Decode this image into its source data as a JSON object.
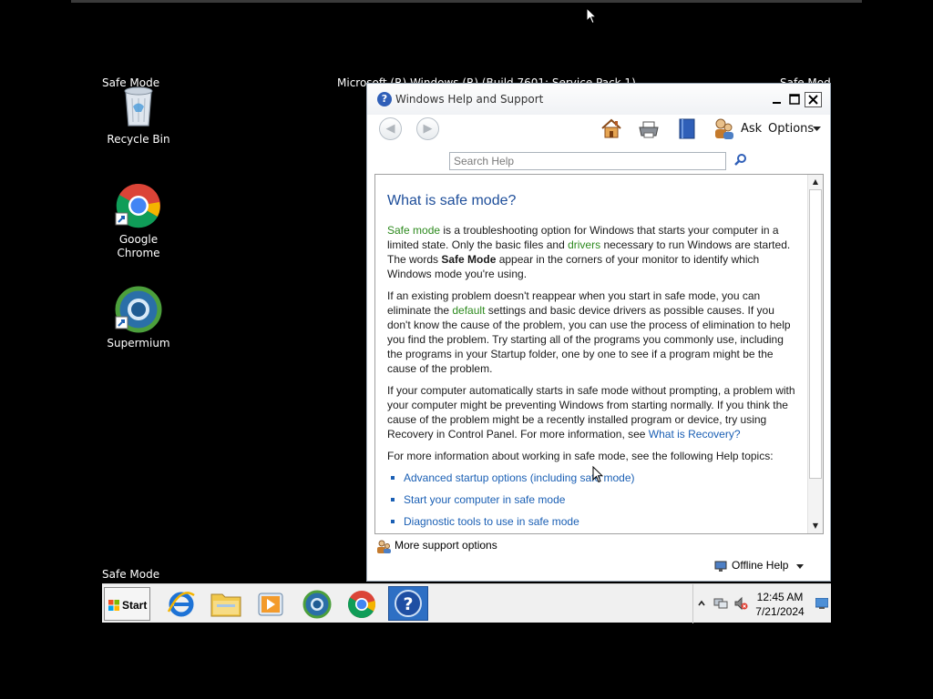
{
  "desktop": {
    "top_left_label": "Safe Mode",
    "top_center_label": "Microsoft (R) Windows (R) (Build 7601: Service Pack 1)",
    "top_right_label": "Safe Mod",
    "bottom_left_label": "Safe Mode",
    "icons": [
      {
        "label": "Recycle Bin",
        "icon": "recycle-bin-icon"
      },
      {
        "label": "Google Chrome",
        "icon": "chrome-icon"
      },
      {
        "label": "Supermium",
        "icon": "supermium-icon"
      }
    ]
  },
  "help_window": {
    "title": "Windows Help and Support",
    "toolbar": {
      "ask_label": "Ask",
      "options_label": "Options"
    },
    "search": {
      "placeholder": "Search Help"
    },
    "article": {
      "heading": "What is safe mode?",
      "p1": {
        "safe_mode_term": "Safe mode",
        "text_a": " is a troubleshooting option for Windows that starts your computer in a limited state. Only the basic files and ",
        "drivers_term": "drivers",
        "text_b": " necessary to run Windows are started. The words ",
        "bold": "Safe Mode",
        "text_c": " appear in the corners of your monitor to identify which Windows mode you're using."
      },
      "p2": {
        "text_a": "If an existing problem doesn't reappear when you start in safe mode, you can eliminate the ",
        "default_term": "default",
        "text_b": " settings and basic device drivers as possible causes. If you don't know the cause of the problem, you can use the process of elimination to help you find the problem. Try starting all of the programs you commonly use, including the programs in your Startup folder, one by one to see if a program might be the cause of the problem."
      },
      "p3": {
        "text_a": "If your computer automatically starts in safe mode without prompting, a problem with your computer might be preventing Windows from starting normally. If you think the cause of the problem might be a recently installed program or device, try using Recovery in Control Panel. For more information, see ",
        "link": "What is Recovery?"
      },
      "p4": "For more information about working in safe mode, see the following Help topics:",
      "links": [
        "Advanced startup options (including safe mode)",
        "Start your computer in safe mode",
        "Diagnostic tools to use in safe mode"
      ]
    },
    "more_support": "More support options",
    "offline_help": "Offline Help"
  },
  "taskbar": {
    "start_label": "Start",
    "apps": [
      "internet-explorer-icon",
      "file-explorer-icon",
      "media-player-icon",
      "supermium-icon",
      "chrome-icon",
      "help-support-icon"
    ],
    "clock_time": "12:45 AM",
    "clock_date": "7/21/2024"
  },
  "colors": {
    "heading": "#1e4e9a",
    "term_green": "#2d8a1e",
    "link_blue": "#1a5fb4",
    "taskbar_active": "#2d6fc4"
  }
}
